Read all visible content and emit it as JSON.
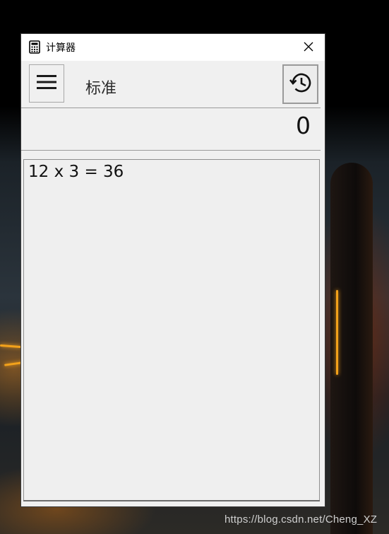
{
  "window": {
    "title": "计算器",
    "icon": "calculator-icon"
  },
  "header": {
    "menu_icon": "hamburger-menu-icon",
    "mode": "标准",
    "history_icon": "history-clock-icon"
  },
  "display": {
    "value": "0"
  },
  "history": {
    "entries": [
      {
        "expression": "12 x 3 = 36"
      }
    ]
  },
  "desktop": {
    "watermark": "https://blog.csdn.net/Cheng_XZ"
  },
  "colors": {
    "window_bg": "#f0f0f0",
    "titlebar_bg": "#ffffff",
    "border": "#9b9b9b"
  }
}
